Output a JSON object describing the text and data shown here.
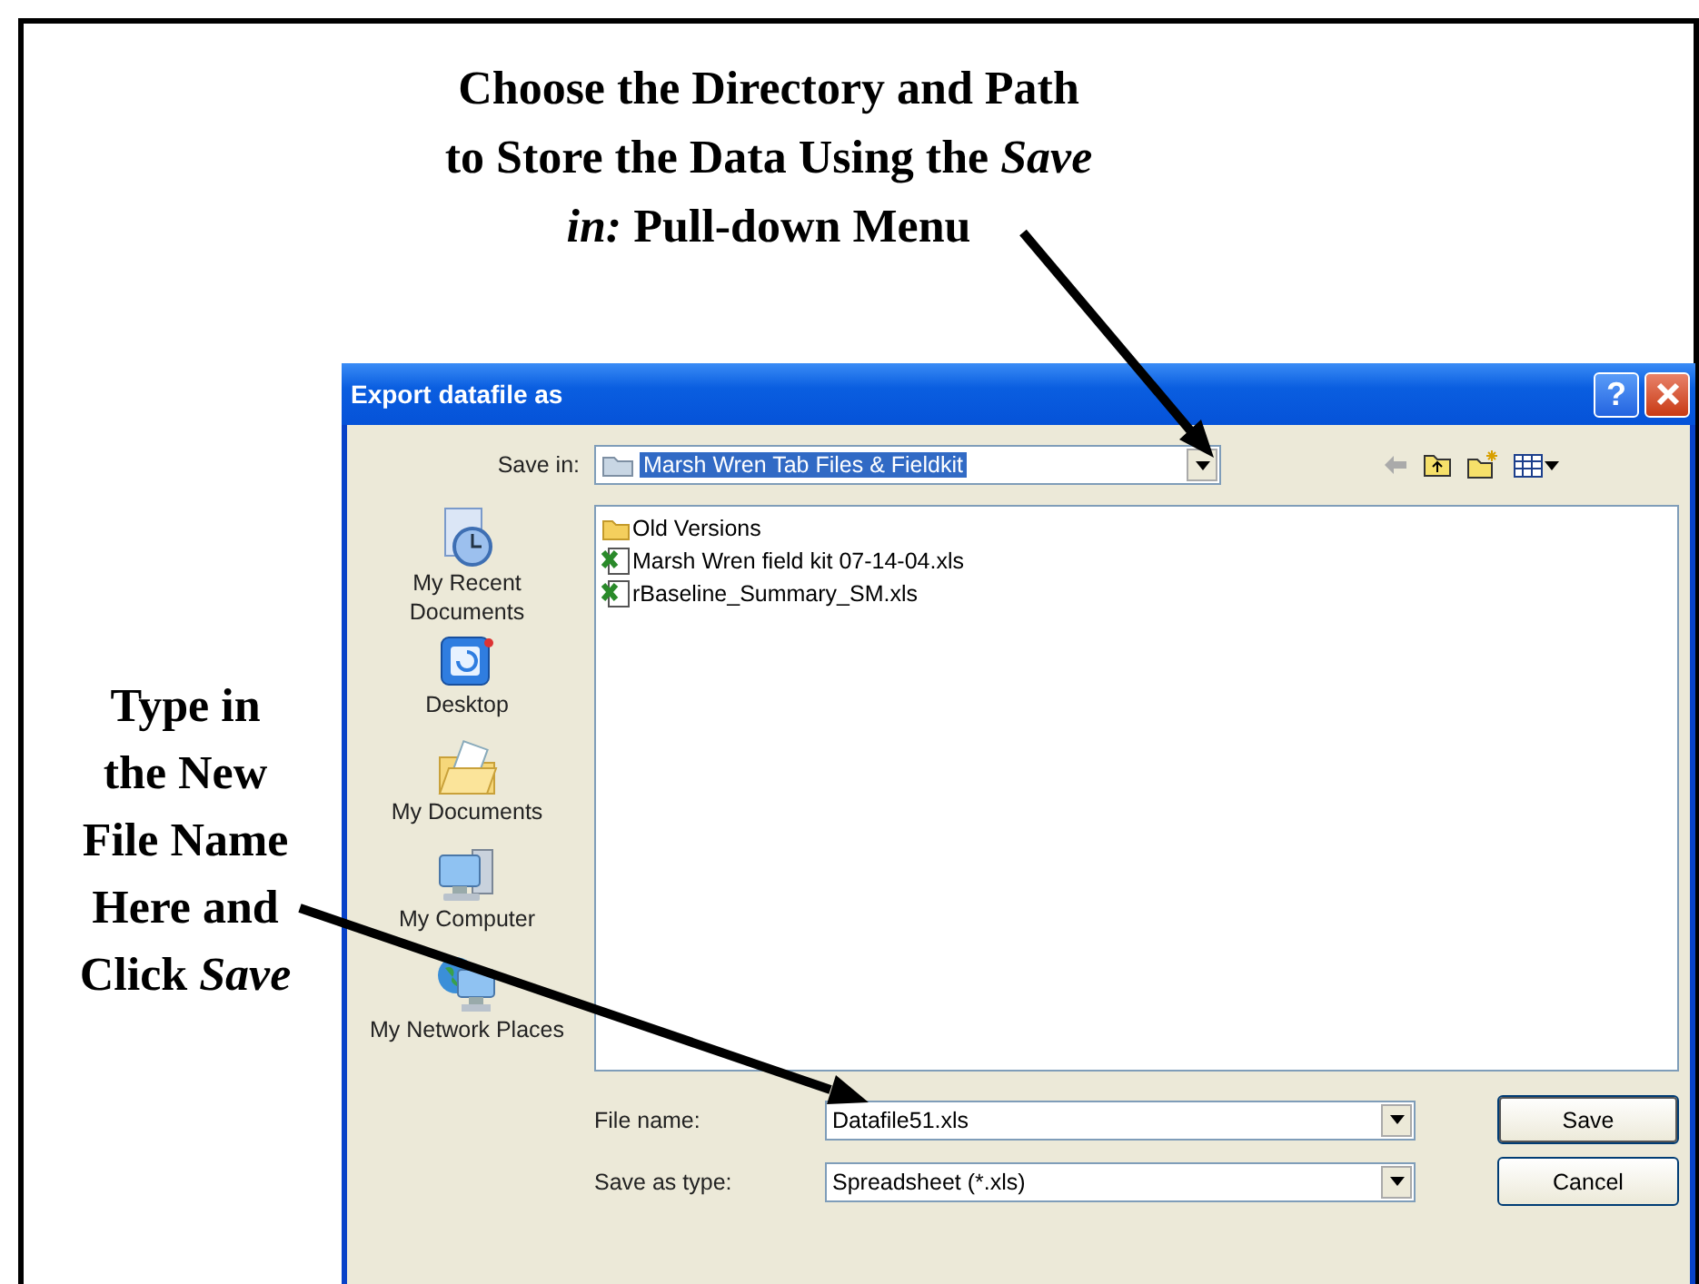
{
  "top_callout": {
    "lines": [
      "Choose the Directory and Path",
      "to Store the Data Using the *Save*",
      "*in:* Pull-down Menu"
    ]
  },
  "left_callout": {
    "lines": [
      "Type in",
      "the New",
      "File Name",
      "Here and",
      "Click *Save*"
    ]
  },
  "dialog": {
    "title": "Export datafile as",
    "help_button": "?",
    "save_in": {
      "label": "Save in:",
      "value": "Marsh Wren Tab Files & Fieldkit",
      "highlighted": true
    },
    "places": [
      {
        "kind": "recent",
        "label": "My Recent Documents"
      },
      {
        "kind": "desktop",
        "label": "Desktop"
      },
      {
        "kind": "documents",
        "label": "My Documents"
      },
      {
        "kind": "computer",
        "label": "My Computer"
      },
      {
        "kind": "network",
        "label": "My Network Places"
      }
    ],
    "files": [
      {
        "kind": "folder",
        "name": "Old Versions"
      },
      {
        "kind": "spreadsheet",
        "name": "Marsh Wren field kit 07-14-04.xls"
      },
      {
        "kind": "spreadsheet",
        "name": "rBaseline_Summary_SM.xls"
      }
    ],
    "file_name": {
      "label": "File name:",
      "value": "Datafile51.xls"
    },
    "save_as_type": {
      "label": "Save as type:",
      "value": "Spreadsheet (*.xls)"
    },
    "buttons": [
      {
        "label": "Save",
        "default": true
      },
      {
        "label": "Cancel",
        "default": false
      }
    ]
  }
}
